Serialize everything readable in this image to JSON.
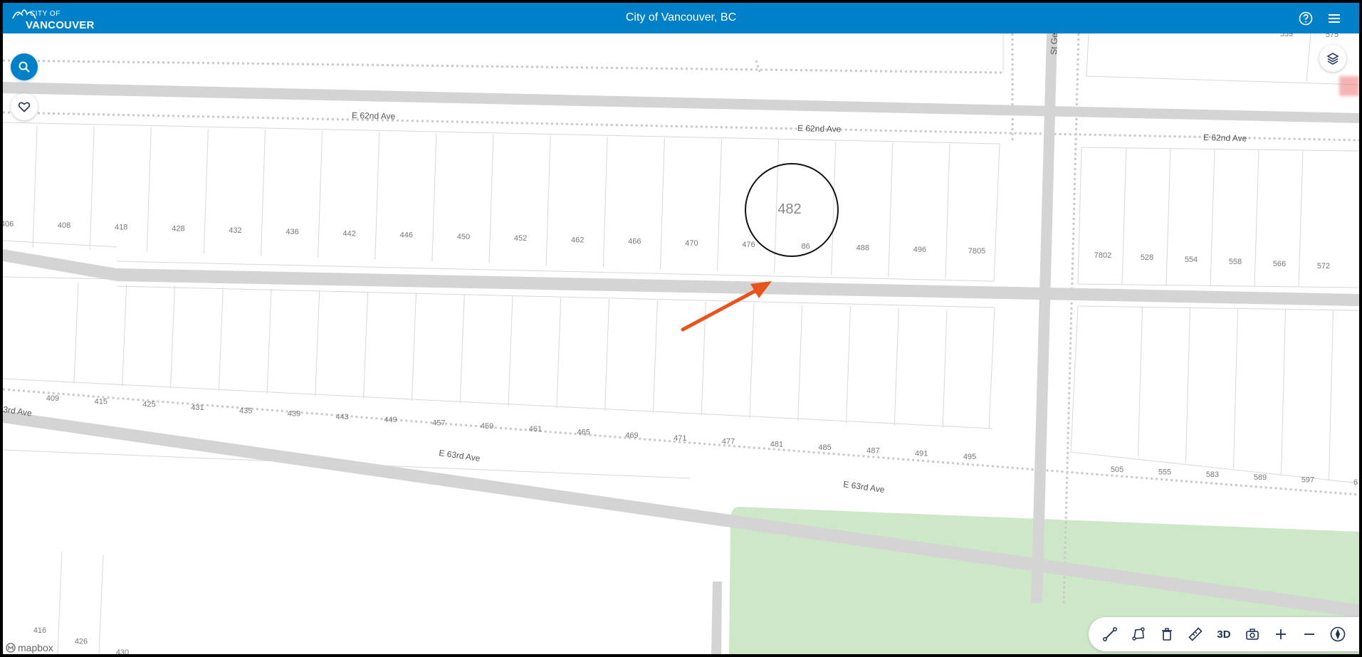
{
  "header": {
    "logo_line1": "CITY OF",
    "logo_line2": "VANCOUVER",
    "title": "City of Vancouver, BC",
    "accent": "#0080c6"
  },
  "map": {
    "streets": [
      {
        "label": "E 62nd Ave"
      },
      {
        "label": "E 62nd Ave"
      },
      {
        "label": "E 62nd Ave"
      },
      {
        "label": "E 63rd Ave"
      },
      {
        "label": "E 63rd Ave"
      },
      {
        "label": "3rd Ave"
      },
      {
        "label": "St Geor"
      }
    ],
    "lots_row1": [
      "406",
      "408",
      "418",
      "428",
      "432",
      "436",
      "442",
      "446",
      "450",
      "452",
      "462",
      "466",
      "470",
      "476",
      "86",
      "488",
      "496",
      "7805"
    ],
    "lots_row1_east": [
      "7802",
      "528",
      "554",
      "558",
      "566",
      "572"
    ],
    "lots_row2": [
      "409",
      "415",
      "425",
      "431",
      "435",
      "439",
      "443",
      "449",
      "457",
      "459",
      "461",
      "465",
      "469",
      "471",
      "477",
      "481",
      "485",
      "487",
      "491",
      "495"
    ],
    "lots_row2_east": [
      "505",
      "555",
      "583",
      "589",
      "597",
      "6"
    ],
    "lots_row3": [
      "416",
      "426",
      "430"
    ],
    "lots_top_east": [
      "559",
      "575"
    ],
    "highlight": {
      "label": "482"
    },
    "attribution": "mapbox",
    "park_color": "#cfe7c9",
    "arrow_color": "#e8541e"
  },
  "controls": {
    "search_icon": "search-icon",
    "favorite_icon": "heart-icon",
    "layers_icon": "layers-icon",
    "toolbar": {
      "line_tool": "line-tool-icon",
      "polygon_tool": "polygon-tool-icon",
      "delete_tool": "trash-icon",
      "measure_tool": "ruler-icon",
      "view_3d_label": "3D",
      "screenshot_tool": "camera-icon",
      "zoom_in": "plus-icon",
      "zoom_out": "minus-icon",
      "compass": "compass-icon"
    }
  }
}
